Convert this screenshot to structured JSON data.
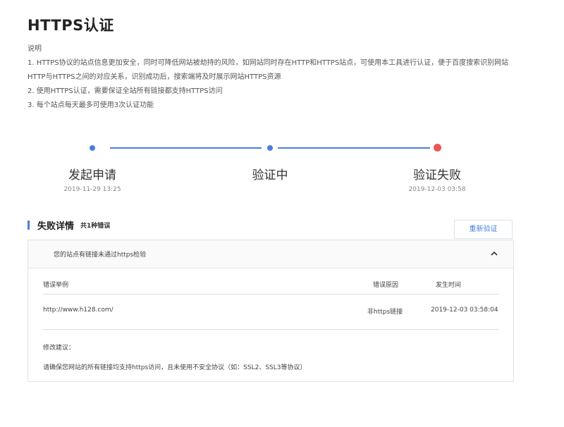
{
  "page": {
    "title": "HTTPS认证"
  },
  "description": {
    "heading": "说明",
    "lines": [
      "1. HTTPS协议的站点信息更加安全，同时可降低网站被劫持的风险，如网站同时存在HTTP和HTTPS站点，可使用本工具进行认证，便于百度搜索识别网站",
      "HTTP与HTTPS之间的对应关系，识别成功后，搜索端将及时展示网站HTTPS资源",
      "2. 使用HTTPS认证，需要保证全站所有链接都支持HTTPS访问",
      "3. 每个站点每天最多可使用3次认证功能"
    ]
  },
  "steps": [
    {
      "label": "发起申请",
      "time": "2019-11-29 13:25",
      "status": "done"
    },
    {
      "label": "验证中",
      "time": "",
      "status": "done"
    },
    {
      "label": "验证失败",
      "time": "2019-12-03 03:58",
      "status": "failed"
    }
  ],
  "failure": {
    "title": "失败详情",
    "count": "共1种错误",
    "reverify_label": "重新验证",
    "panel_title": "您的站点有链接未通过https检验",
    "columns": {
      "example": "错误举例",
      "reason": "错误原因",
      "time": "发生时间"
    },
    "rows": [
      {
        "example": "http://www.h128.com/",
        "reason": "非https链接",
        "time": "2019-12-03 03:58:04"
      }
    ],
    "advice_label": "修改建议：",
    "advice_text": "请确保您网站的所有链接均支持https访问，且未使用不安全协议（如：SSL2、SSL3等协议）"
  },
  "colors": {
    "accent": "#4a7fd9",
    "fail": "#ee5555"
  },
  "icons": {
    "collapse": "chevron-up-icon"
  }
}
